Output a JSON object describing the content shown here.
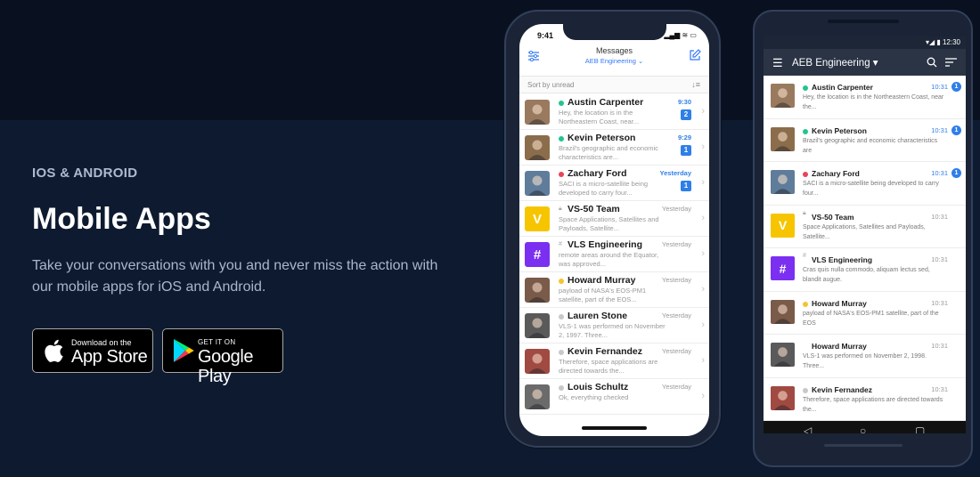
{
  "hero": {
    "eyebrow": "IOS & ANDROID",
    "title": "Mobile Apps",
    "description": "Take your conversations with you and never miss the action with our mobile apps for iOS and Android."
  },
  "stores": {
    "apple": {
      "small": "Download on the",
      "big": "App Store"
    },
    "google": {
      "small": "GET IT ON",
      "big": "Google Play"
    }
  },
  "iphone": {
    "time": "9:41",
    "status_icons": "▂▄▆ ≋ ▭",
    "header_title": "Messages",
    "header_subtitle": "AEB Engineering ⌄",
    "sort_label": "Sort by unread",
    "rows": [
      {
        "name": "Austin Carpenter",
        "preview": "Hey, the location is in the Northeastern Coast, near...",
        "time": "9:30",
        "badge": "2",
        "dot": "#22c58b",
        "avatar": "#9a7a5e"
      },
      {
        "name": "Kevin Peterson",
        "preview": "Brazil's geographic and economic characteristics are...",
        "time": "9:29",
        "badge": "1",
        "dot": "#22c58b",
        "avatar": "#8b6d4c"
      },
      {
        "name": "Zachary Ford",
        "preview": "SACI is a micro-satellite being developed to carry four...",
        "time": "Yesterday",
        "badge": "1",
        "dot": "#e8455a",
        "avatar": "#5f7c9a"
      },
      {
        "name": "VS-50 Team",
        "preview": "Space Applications, Satellites and Payloads, Satellite...",
        "time": "Yesterday",
        "letter": "V",
        "avatar": "#f6c500"
      },
      {
        "name": "VLS Engineering",
        "preview": "remote areas around the Equator, was approved...",
        "time": "Yesterday",
        "letter": "#",
        "avatar": "#7b2ff0"
      },
      {
        "name": "Howard Murray",
        "preview": "payload of NASA's EOS-PM1 satellite, part of the EOS...",
        "time": "Yesterday",
        "dot": "#f4c430",
        "avatar": "#7a5a48"
      },
      {
        "name": "Lauren Stone",
        "preview": "VLS-1 was performed on November 2, 1997. Three...",
        "time": "Yesterday",
        "dot": "#c8c8c8",
        "avatar": "#5a5a5a"
      },
      {
        "name": "Kevin Fernandez",
        "preview": "Therefore, space applications are directed towards the...",
        "time": "Yesterday",
        "dot": "#c8c8c8",
        "avatar": "#a04a42"
      },
      {
        "name": "Louis Schultz",
        "preview": "Ok, everything checked",
        "time": "Yesterday",
        "dot": "#c8c8c8",
        "avatar": "#6b6b6b"
      }
    ]
  },
  "android": {
    "status": "▾◢ ▮ 12:30",
    "workspace": "AEB Engineering ▾",
    "rows": [
      {
        "name": "Austin Carpenter",
        "preview": "Hey, the location is in the Northeastern Coast, near the...",
        "time": "10:31",
        "badge": "1",
        "dot": "#22c58b",
        "avatar": "#9a7a5e"
      },
      {
        "name": "Kevin Peterson",
        "preview": "Brazil's geographic and economic characteristics are",
        "time": "10:31",
        "badge": "1",
        "dot": "#22c58b",
        "avatar": "#8b6d4c"
      },
      {
        "name": "Zachary Ford",
        "preview": "SACI is a micro-satellite being developed to carry four...",
        "time": "10:31",
        "badge": "1",
        "dot": "#e8455a",
        "avatar": "#5f7c9a"
      },
      {
        "name": "VS-50 Team",
        "preview": "Space Applications, Satellites  and Payloads, Satellite...",
        "time": "10:31",
        "letter": "V",
        "avatar": "#f6c500"
      },
      {
        "name": "VLS Engineering",
        "preview": "Cras quis nulla commodo, aliquam lectus sed, blandit augue.",
        "time": "10:31",
        "letter": "#",
        "avatar": "#7b2ff0"
      },
      {
        "name": "Howard Murray",
        "preview": "payload of NASA's EOS-PM1 satellite, part of the EOS",
        "time": "10:31",
        "dot": "#f4c430",
        "avatar": "#7a5a48"
      },
      {
        "name": "Howard Murray",
        "preview": "VLS-1 was performed on November 2, 1998. Three...",
        "time": "10:31",
        "avatar": "#5a5a5a"
      },
      {
        "name": "Kevin Fernandez",
        "preview": "Therefore, space applications are directed towards the...",
        "time": "10:31",
        "dot": "#c8c8c8",
        "avatar": "#a04a42"
      }
    ],
    "nav": {
      "back": "◁",
      "home": "○",
      "recent": "▢"
    }
  }
}
